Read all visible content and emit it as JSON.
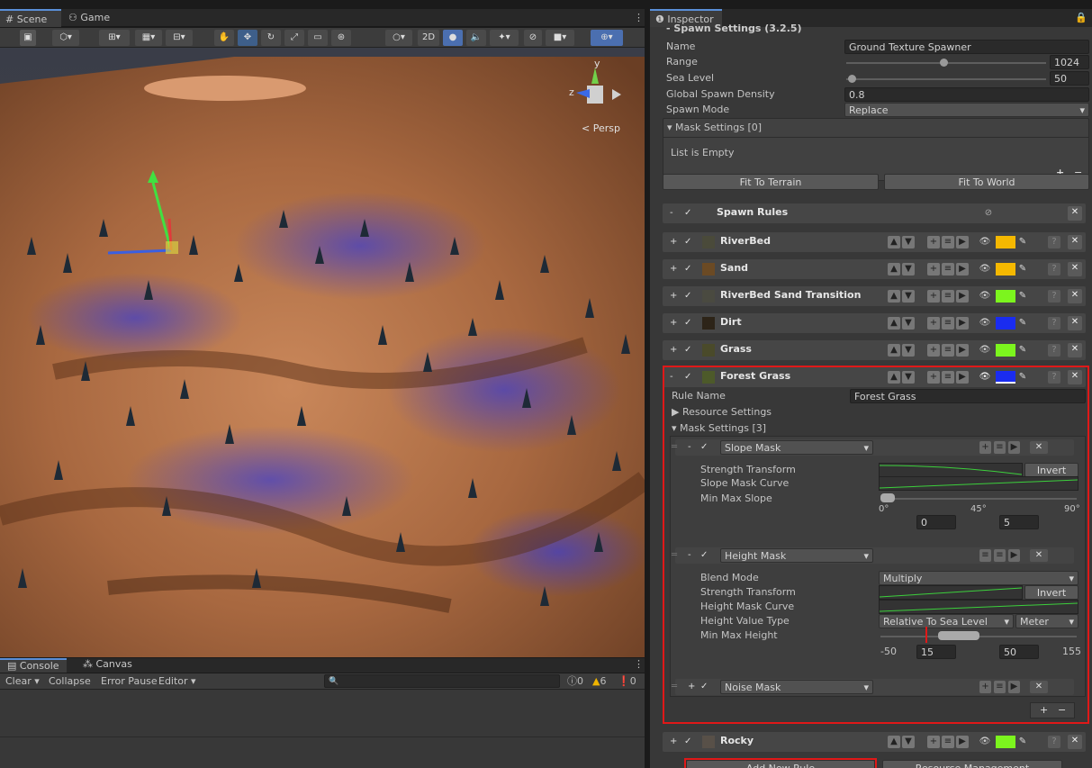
{
  "scene_tabs": {
    "scene": "Scene",
    "game": "Game"
  },
  "toolbar": {
    "view_2d": "2D"
  },
  "scene_view": {
    "persp": "Persp",
    "axis_y": "y",
    "axis_z": "z"
  },
  "console": {
    "console_tab": "Console",
    "canvas_tab": "Canvas",
    "clear": "Clear",
    "collapse": "Collapse",
    "error_pause": "Error Pause",
    "editor": "Editor",
    "info_count": "0",
    "warn_count": "6",
    "error_count": "0"
  },
  "inspector": {
    "tab": "Inspector",
    "header": "Spawn Settings (3.2.5)",
    "name_label": "Name",
    "name_value": "Ground Texture Spawner",
    "range_label": "Range",
    "range_value": "1024",
    "sea_label": "Sea Level",
    "sea_value": "50",
    "density_label": "Global Spawn Density",
    "density_value": "0.8",
    "mode_label": "Spawn Mode",
    "mode_value": "Replace",
    "mask_settings": "Mask Settings [0]",
    "list_empty": "List is Empty",
    "fit_terrain": "Fit To Terrain",
    "fit_world": "Fit To World",
    "spawn_rules": "Spawn Rules",
    "rules": [
      {
        "name": "RiverBed",
        "color": "#f5b800",
        "swatch": "#4a4a3a"
      },
      {
        "name": "Sand",
        "color": "#f5b800",
        "swatch": "#6b4a24"
      },
      {
        "name": "RiverBed Sand Transition",
        "color": "#7cf51e",
        "swatch": "#4a4a40"
      },
      {
        "name": "Dirt",
        "color": "#1a2cf0",
        "swatch": "#2d2418"
      },
      {
        "name": "Grass",
        "color": "#7cf51e",
        "swatch": "#4a4a2a"
      }
    ],
    "forest": {
      "name": "Forest Grass",
      "color": "#1a2cf0",
      "rule_name_label": "Rule Name",
      "rule_name_value": "Forest Grass",
      "resource_settings": "Resource Settings",
      "mask_settings": "Mask Settings [3]",
      "slope": {
        "title": "Slope Mask",
        "strength": "Strength Transform",
        "curve": "Slope Mask Curve",
        "minmax": "Min Max Slope",
        "invert": "Invert",
        "t0": "0°",
        "t45": "45°",
        "t90": "90°",
        "min": "0",
        "max": "5"
      },
      "height": {
        "title": "Height Mask",
        "blend": "Blend Mode",
        "blend_value": "Multiply",
        "strength": "Strength Transform",
        "curve": "Height Mask Curve",
        "type": "Height Value Type",
        "type_value": "Relative To Sea Level",
        "unit": "Meter",
        "minmax": "Min Max Height",
        "invert": "Invert",
        "lo": "-50",
        "min": "15",
        "max": "50",
        "hi": "155"
      },
      "noise": {
        "title": "Noise Mask"
      }
    },
    "rocky": {
      "name": "Rocky",
      "color": "#7cf51e"
    },
    "add_rule": "Add New Rule",
    "resource_mgmt": "Resource Management"
  }
}
